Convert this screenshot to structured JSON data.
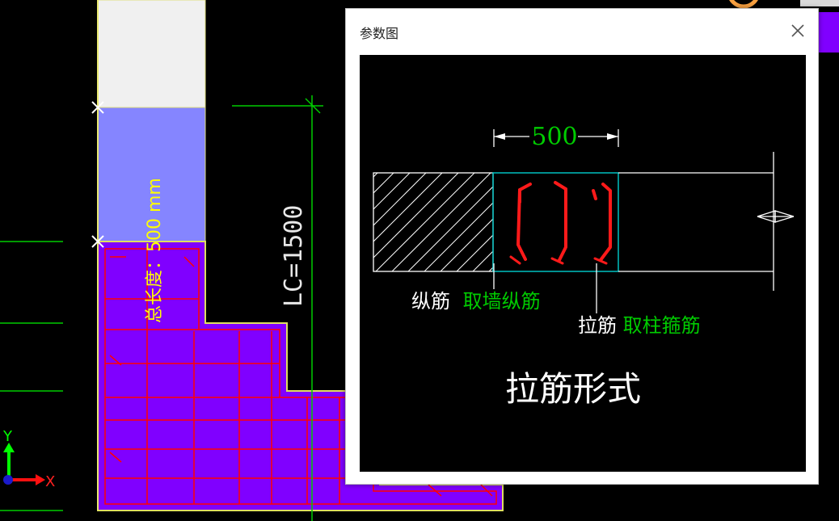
{
  "cad": {
    "length_label": "总长度：500 mm",
    "lc_label": "LC=1500",
    "axis_x": "X",
    "axis_y": "Y"
  },
  "dialog": {
    "title": "参数图",
    "close_icon": "close-icon",
    "diagram": {
      "dimension": "500",
      "longitudinal_label": "纵筋",
      "longitudinal_value": "取墙纵筋",
      "tie_label": "拉筋",
      "tie_value": "取柱箍筋",
      "caption": "拉筋形式"
    }
  },
  "colors": {
    "background": "#000000",
    "wall_fill": "#8000ff",
    "wall_light": "#8080ff",
    "rebar": "#ff0000",
    "dim_green": "#00cc00",
    "label_yellow": "#ffff00",
    "tie_red": "#ff1a1a",
    "section_cyan": "#00c0c0"
  }
}
